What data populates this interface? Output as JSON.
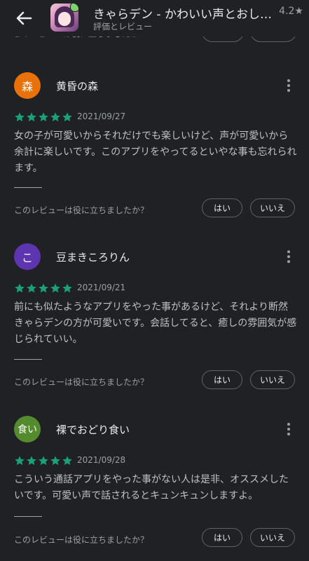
{
  "header": {
    "title": "きゃらデン - かわいい声とおしゃ...",
    "subtitle": "評価とレビュー",
    "rating": "4.2★"
  },
  "colors": {
    "background": "#202124",
    "star": "#1aa17a",
    "avatar_1": "#e8710a",
    "avatar_2": "#5e35b1",
    "avatar_3": "#558b2f"
  },
  "previous_helpful_text": "このレビューは役に立ちましたか？",
  "reviews": [
    {
      "avatar_letter": "森",
      "name": "黄昏の森",
      "stars": 5,
      "date": "2021/09/27",
      "body": "女の子が可愛いからそれだけでも楽しいけど、声が可愛いから余計に楽しいです。このアプリをやってるといやな事も忘れられます。",
      "helpful_question": "このレビューは役に立ちましたか？",
      "yes_label": "はい",
      "no_label": "いいえ"
    },
    {
      "avatar_letter": "こ",
      "name": "豆まきころりん",
      "stars": 5,
      "date": "2021/09/21",
      "body": "前にも似たようなアプリをやった事があるけど、それより断然きゃらデンの方が可愛いです。会話してると、癒しの雰囲気が感じられていい。",
      "helpful_question": "このレビューは役に立ちましたか？",
      "yes_label": "はい",
      "no_label": "いいえ"
    },
    {
      "avatar_letter": "食い",
      "name": "裸でおどり食い",
      "stars": 5,
      "date": "2021/09/28",
      "body": "こういう通話アプリをやった事がない人は是非、オススメしたいです。可愛い声で話されるとキュンキュンしますよ。",
      "helpful_question": "このレビューは役に立ちましたか？",
      "yes_label": "はい",
      "no_label": "いいえ"
    }
  ]
}
